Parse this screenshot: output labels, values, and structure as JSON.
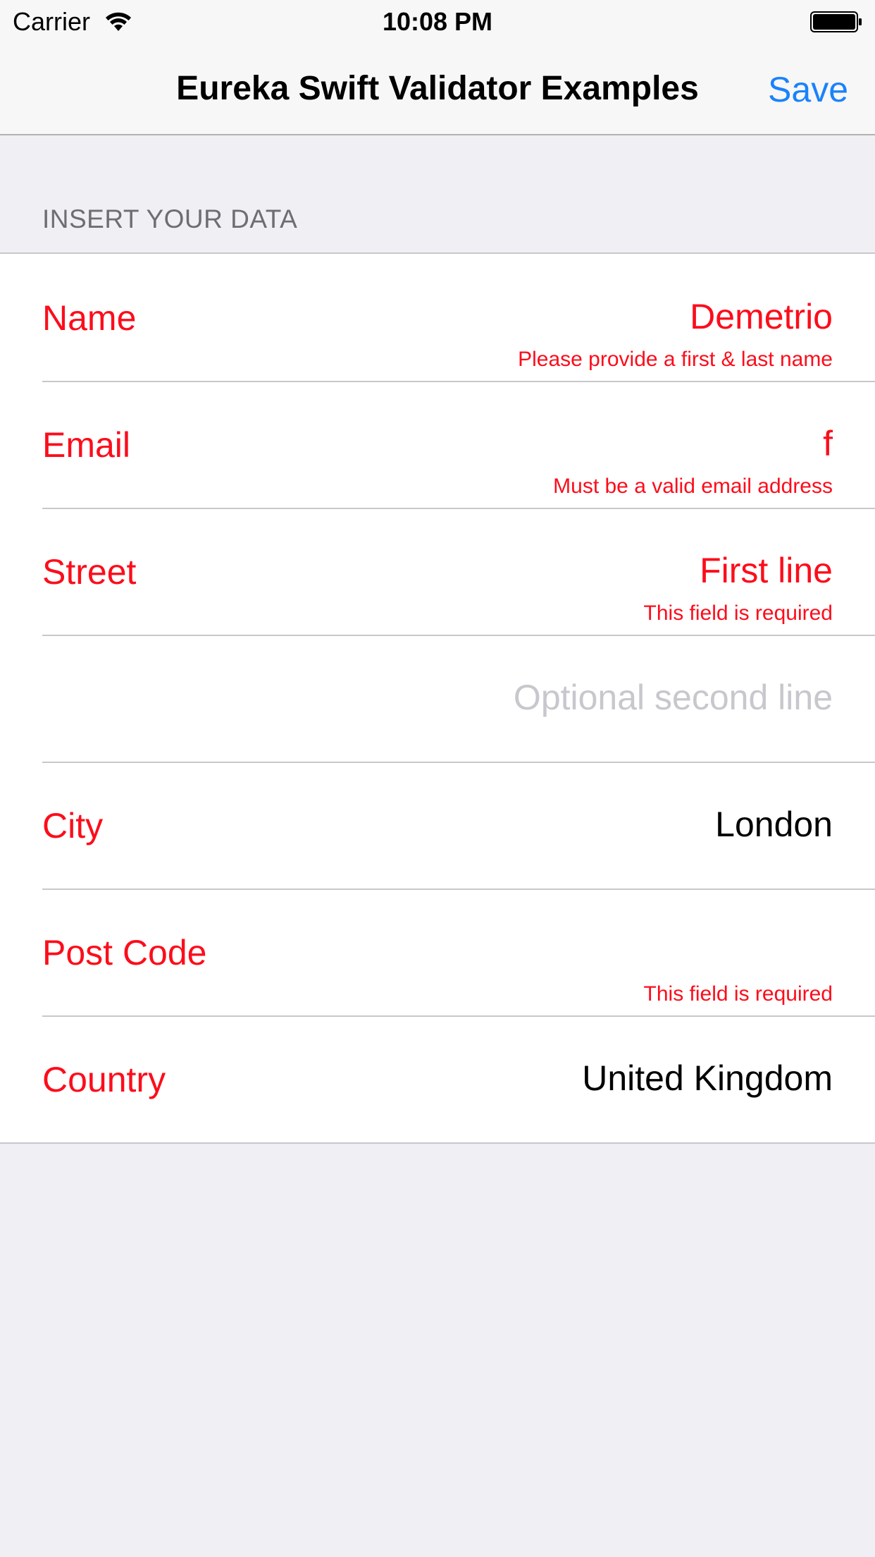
{
  "status_bar": {
    "carrier": "Carrier",
    "time": "10:08 PM",
    "wifi_icon": "wifi-icon",
    "battery_icon": "battery-icon"
  },
  "nav": {
    "title": "Eureka Swift Validator Examples",
    "save_label": "Save"
  },
  "section": {
    "header": "INSERT YOUR DATA"
  },
  "colors": {
    "error_red": "#fc0d1b",
    "accent_blue": "#1a82fb",
    "placeholder_gray": "#c7c7cd",
    "background": "#efeff4"
  },
  "rows": [
    {
      "label": "Name",
      "value": "Demetrio",
      "error": "Please provide a first & last name"
    },
    {
      "label": "Email",
      "value": "f",
      "error": "Must be a valid email address"
    },
    {
      "label": "Street",
      "value": "First line",
      "error": "This field is required"
    },
    {
      "label": "",
      "value": "",
      "placeholder": "Optional second line",
      "error": ""
    },
    {
      "label": "City",
      "value": "London",
      "error": ""
    },
    {
      "label": "Post Code",
      "value": "",
      "error": "This field is required"
    },
    {
      "label": "Country",
      "value": "United Kingdom",
      "error": ""
    }
  ]
}
